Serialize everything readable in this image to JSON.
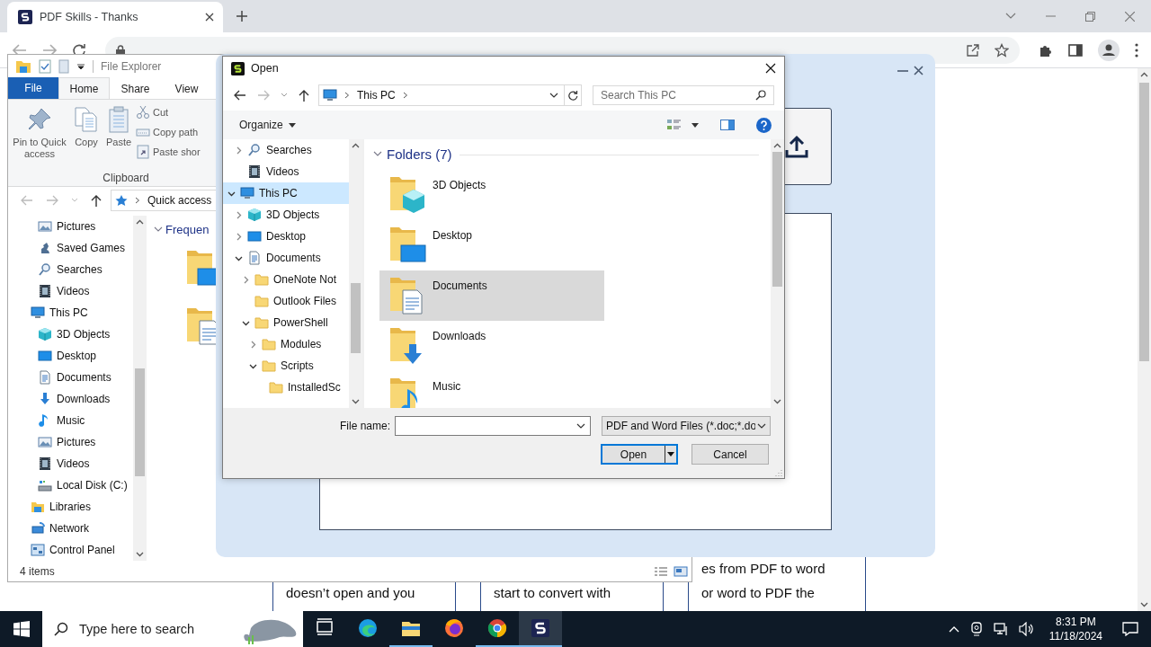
{
  "browser": {
    "tab_title": "PDF Skills - Thanks"
  },
  "page": {
    "cards": [
      {
        "lines": [
          "doesn’t open and you"
        ]
      },
      {
        "lines": [
          "start to convert with"
        ]
      },
      {
        "lines": [
          "es from PDF to word",
          "or word to PDF the"
        ]
      }
    ]
  },
  "file_explorer": {
    "title": "File Explorer",
    "file_menu": "File",
    "ribbon_tabs": [
      {
        "label": "Home",
        "selected": true
      },
      {
        "label": "Share",
        "selected": false
      },
      {
        "label": "View",
        "selected": false
      }
    ],
    "large_commands": [
      {
        "label": "Pin to Quick access",
        "kind": "pin"
      },
      {
        "label": "Copy",
        "kind": "copy"
      },
      {
        "label": "Paste",
        "kind": "paste"
      }
    ],
    "small_commands": [
      {
        "label": "Cut",
        "kind": "cut"
      },
      {
        "label": "Copy path",
        "kind": "copy-path"
      },
      {
        "label": "Paste shor",
        "kind": "paste-shortcut"
      }
    ],
    "group_label": "Clipboard",
    "address": "Quick access",
    "nav_items": [
      {
        "children": [
          {
            "label": "Pictures",
            "kind": "pictures"
          },
          {
            "label": "Saved Games",
            "kind": "games"
          },
          {
            "label": "Searches",
            "kind": "search"
          },
          {
            "label": "Videos",
            "kind": "videos"
          }
        ]
      },
      {
        "label": "This PC",
        "kind": "pc",
        "children": [
          {
            "label": "3D Objects",
            "kind": "cube"
          },
          {
            "label": "Desktop",
            "kind": "desktop"
          },
          {
            "label": "Documents",
            "kind": "documents"
          },
          {
            "label": "Downloads",
            "kind": "downloads"
          },
          {
            "label": "Music",
            "kind": "music"
          },
          {
            "label": "Pictures",
            "kind": "pictures"
          },
          {
            "label": "Videos",
            "kind": "videos"
          },
          {
            "label": "Local Disk (C:)",
            "kind": "disk"
          }
        ]
      },
      {
        "label": "Libraries",
        "kind": "libraries"
      },
      {
        "label": "Network",
        "kind": "network"
      },
      {
        "label": "Control Panel",
        "kind": "control-panel"
      }
    ],
    "section_title": "Frequen",
    "status": "4 items"
  },
  "open_dialog": {
    "title": "Open",
    "address": "This PC",
    "search_placeholder": "Search This PC",
    "organize": "Organize",
    "tree": [
      {
        "children": [
          {
            "label": "Searches",
            "kind": "search",
            "expanded": false,
            "selected": false
          },
          {
            "label": "Videos",
            "kind": "videos",
            "selected": false
          }
        ]
      },
      {
        "label": "This PC",
        "kind": "pc",
        "expanded": true,
        "selected": true,
        "children": [
          {
            "label": "3D Objects",
            "kind": "cube",
            "expanded": false,
            "selected": false
          },
          {
            "label": "Desktop",
            "kind": "desktop",
            "expanded": false,
            "selected": false
          },
          {
            "label": "Documents",
            "kind": "documents",
            "expanded": true,
            "selected": false,
            "children": [
              {
                "label": "OneNote Not",
                "kind": "folder",
                "expanded": false,
                "selected": false
              },
              {
                "label": "Outlook Files",
                "kind": "folder",
                "selected": false
              },
              {
                "label": "PowerShell",
                "kind": "folder",
                "expanded": true,
                "selected": false,
                "children": [
                  {
                    "label": "Modules",
                    "kind": "folder",
                    "expanded": false,
                    "selected": false
                  },
                  {
                    "label": "Scripts",
                    "kind": "folder",
                    "expanded": true,
                    "selected": false,
                    "children": [
                      {
                        "label": "InstalledSc",
                        "kind": "folder",
                        "selected": false
                      }
                    ]
                  }
                ]
              }
            ]
          }
        ]
      }
    ],
    "group_title": "Folders (7)",
    "folders": [
      {
        "label": "3D Objects",
        "kind": "cube",
        "selected": false
      },
      {
        "label": "Desktop",
        "kind": "desktop",
        "selected": false
      },
      {
        "label": "Documents",
        "kind": "documents",
        "selected": true
      },
      {
        "label": "Downloads",
        "kind": "downloads",
        "selected": false
      },
      {
        "label": "Music",
        "kind": "music",
        "selected": false
      }
    ],
    "file_name_label": "File name:",
    "file_type": "PDF and Word Files (*.doc;*.do",
    "buttons": [
      {
        "label": "Open",
        "kind": "split",
        "default": true
      },
      {
        "label": "Cancel",
        "kind": "plain",
        "default": false
      }
    ]
  },
  "taskbar": {
    "search_placeholder": "Type here to search",
    "apps": [
      {
        "kind": "task-view",
        "running": false,
        "selected": false
      },
      {
        "kind": "edge",
        "running": false,
        "selected": false
      },
      {
        "kind": "explorer",
        "running": true,
        "selected": false
      },
      {
        "kind": "firefox",
        "running": false,
        "selected": false
      },
      {
        "kind": "chrome",
        "running": true,
        "selected": false
      },
      {
        "kind": "logo",
        "running": true,
        "selected": true
      }
    ],
    "time": "8:31 PM",
    "date": "11/18/2024"
  }
}
